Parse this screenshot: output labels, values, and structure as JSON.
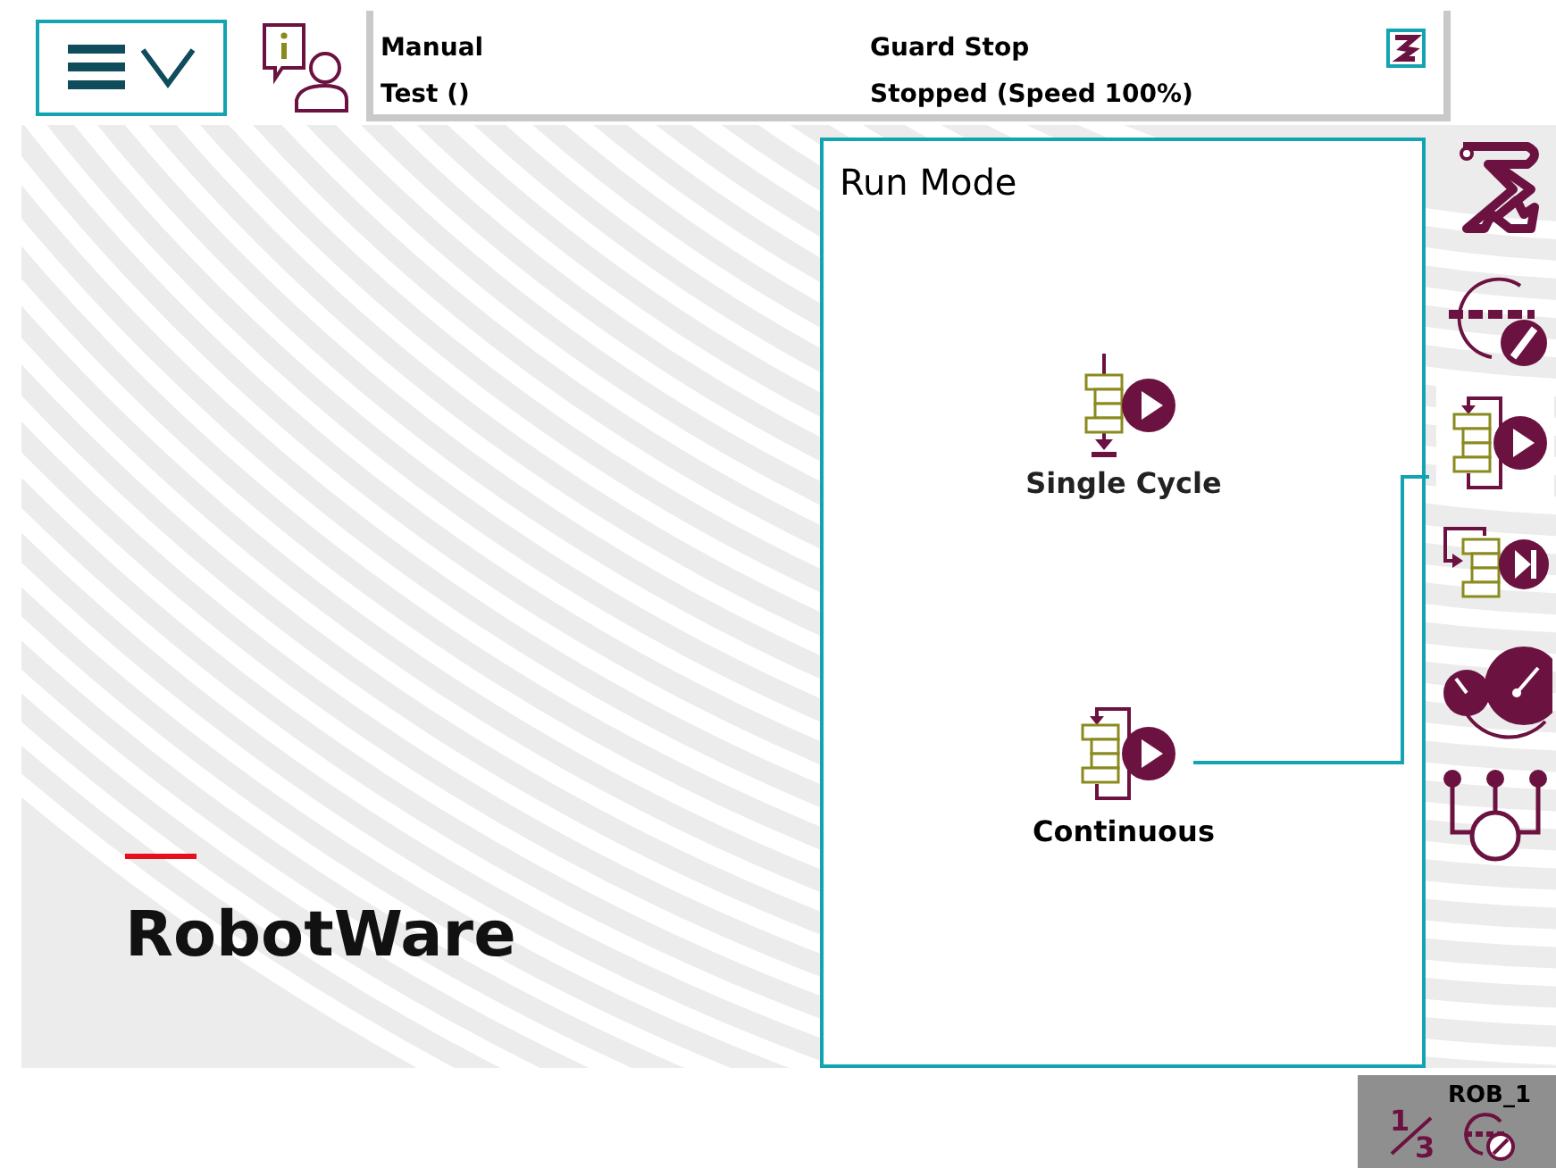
{
  "status": {
    "operating_mode": "Manual",
    "program": "Test ()",
    "safety_state": "Guard Stop",
    "run_state": "Stopped (Speed 100%)"
  },
  "brand": {
    "name": "RobotWare"
  },
  "run_mode_panel": {
    "title": "Run Mode",
    "options": [
      {
        "label": "Single Cycle",
        "kind": "single",
        "selected": false
      },
      {
        "label": "Continuous",
        "kind": "continuous",
        "selected": true
      }
    ]
  },
  "quick_settings": [
    {
      "kind": "mechunit",
      "selected": false
    },
    {
      "kind": "increment",
      "selected": false
    },
    {
      "kind": "runmode",
      "selected": true
    },
    {
      "kind": "stepmode",
      "selected": false
    },
    {
      "kind": "speed",
      "selected": false
    },
    {
      "kind": "tasks",
      "selected": false
    }
  ],
  "task_selector": {
    "unit": "ROB_1",
    "numerator": "1",
    "denominator": "3"
  }
}
